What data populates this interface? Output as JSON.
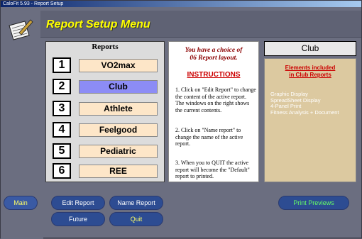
{
  "window": {
    "title": "CaloFit 5.93 - Report Setup"
  },
  "header": {
    "title": "Report Setup Menu"
  },
  "reports": {
    "title": "Reports",
    "items": [
      {
        "num": "1",
        "label": "VO2max"
      },
      {
        "num": "2",
        "label": "Club",
        "active": true
      },
      {
        "num": "3",
        "label": "Athlete"
      },
      {
        "num": "4",
        "label": "Feelgood"
      },
      {
        "num": "5",
        "label": "Pediatric"
      },
      {
        "num": "6",
        "label": "REE"
      }
    ]
  },
  "instructions": {
    "choice_line1": "You have a choice of",
    "choice_line2": "06 Report layout.",
    "heading": "INSTRUCTIONS",
    "step1": "1.  Click on \"Edit Report\" to change the content of the active report. The windows on the right shows  the current contents.",
    "step2": "2.  Click on \"Name report\" to change the name of the active report.",
    "step3": "3.  When you to QUIT the active report will become the \"Default\" report to printed."
  },
  "club": {
    "header": "Club",
    "title_line1": "Elements included",
    "title_line2": "in Club Reports",
    "elements": [
      "Graphic Display",
      "SpreadSheet Display",
      "4-Panel Print",
      "Fitness Analysis + Document"
    ]
  },
  "buttons": {
    "main": "Main",
    "edit_report": "Edit Report",
    "name_report": "Name Report",
    "future": "Future",
    "quit": "Quit",
    "print_previews": "Print Previews"
  },
  "colors": {
    "title_yellow": "#ffff00",
    "active_report": "#8c8cf5",
    "report_button": "#fde6c8",
    "club_panel": "#dcc9a0",
    "pill_button": "#2d4c92"
  }
}
